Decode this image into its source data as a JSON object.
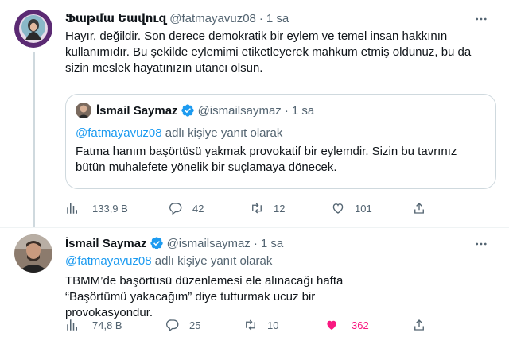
{
  "tweet1": {
    "name": "Ֆաթմա Եավուզ",
    "handle": "@fatmayavuz08",
    "dot": "·",
    "time": "1 sa",
    "text": "Hayır, değildir. Son derece demokratik bir eylem ve temel insan hakkının kullanımıdır.  Bu şekilde eylemimi etiketleyerek mahkum etmiş oldunuz, bu da sizin meslek hayatınızın utancı olsun.",
    "quote": {
      "name": "İsmail Saymaz",
      "handle": "@ismailsaymaz",
      "dot": "·",
      "time": "1 sa",
      "reply_mention": "@fatmayavuz08",
      "reply_suffix": " adlı kişiye yanıt olarak",
      "text": "Fatma hanım başörtüsü yakmak provokatif bir eylemdir. Sizin bu tavrınız bütün muhalefete yönelik bir suçlamaya dönecek."
    },
    "stats": {
      "views": "133,9 B",
      "replies": "42",
      "retweets": "12",
      "likes": "101"
    }
  },
  "tweet2": {
    "name": "İsmail Saymaz",
    "handle": "@ismailsaymaz",
    "dot": "·",
    "time": "1 sa",
    "reply_mention": "@fatmayavuz08",
    "reply_suffix": " adlı kişiye yanıt olarak",
    "text": "TBMM’de başörtüsü düzenlemesi ele alınacağı hafta “Başörtümü yakacağım” diye tutturmak ucuz bir provokasyondur.",
    "stats": {
      "views": "74,8 B",
      "replies": "25",
      "retweets": "10",
      "likes": "362"
    }
  },
  "colors": {
    "link": "#1d9bf0",
    "muted": "#536471",
    "like": "#f91880",
    "verified": "#1d9bf0"
  },
  "icons": [
    "more-icon",
    "verified-badge-icon",
    "views-icon",
    "reply-icon",
    "retweet-icon",
    "like-icon",
    "share-icon"
  ]
}
